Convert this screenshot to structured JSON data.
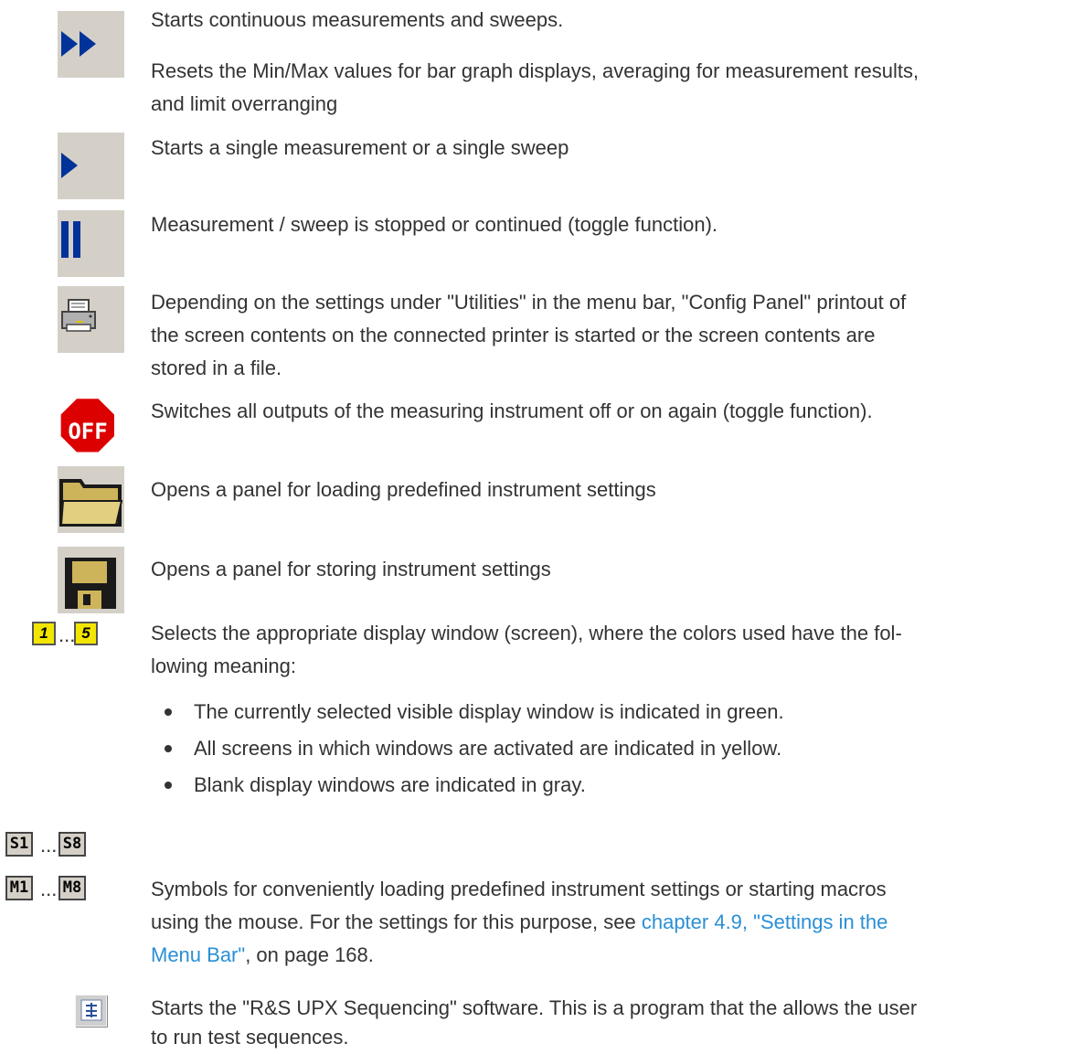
{
  "rows": {
    "continuous": {
      "line1": "Starts continuous measurements and sweeps.",
      "line2": "Resets the Min/Max values for bar graph displays, averaging for measurement results,",
      "line3": "and limit overranging"
    },
    "single": {
      "line1": "Starts a single measurement or a single sweep"
    },
    "pause": {
      "line1": "Measurement / sweep is stopped or continued (toggle function)."
    },
    "print": {
      "line1": "Depending on the settings under \"Utilities\" in the menu bar, \"Config Panel\" printout of",
      "line2": "the screen contents on the connected printer is started or the screen contents are",
      "line3": "stored in a file."
    },
    "off": {
      "icon_text": "OFF",
      "line1": "Switches all outputs of the measuring instrument off or on again (toggle function)."
    },
    "load": {
      "line1": "Opens a panel for loading predefined instrument settings"
    },
    "store": {
      "line1": "Opens a panel for storing instrument settings"
    },
    "windows": {
      "btn_first": "1",
      "btn_last": "5",
      "ellipsis": "...",
      "line1": "Selects the appropriate display window (screen), where the colors used have the fol-",
      "line2": "lowing meaning:",
      "bullets": [
        "The currently selected visible display window is indicated in green.",
        "All screens in which windows are activated are indicated in yellow.",
        "Blank display windows are indicated in gray."
      ]
    },
    "settings_buttons": {
      "btn_first": "S1",
      "btn_last": "S8",
      "ellipsis": "..."
    },
    "macro_buttons": {
      "btn_first": "M1",
      "btn_last": "M8",
      "ellipsis": "...",
      "line1": "Symbols for conveniently loading predefined instrument settings or starting macros",
      "line2_pre": "using the mouse. For the settings for this purpose, see ",
      "link1": "chapter 4.9, \"Settings in the",
      "link2": "Menu Bar\"",
      "line3_post": ", on page 168."
    },
    "sequencing": {
      "line1": "Starts the \"R&S UPX Sequencing\" software. This is a program that the allows the user",
      "line2": "to run test sequences."
    }
  },
  "colors": {
    "icon_blue": "#003399",
    "icon_bg": "#d4d0c8",
    "link": "#2a8fd6",
    "stop_red": "#dd0000",
    "num_yellow": "#f2e600"
  }
}
